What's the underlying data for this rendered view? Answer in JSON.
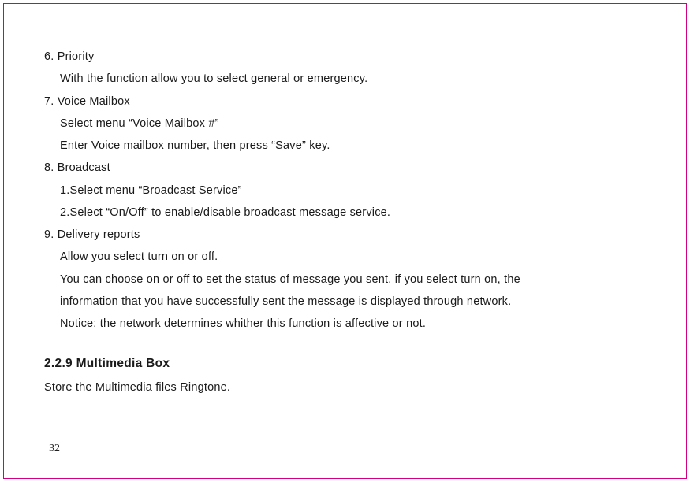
{
  "items": [
    {
      "num": "6",
      "title": "Priority",
      "lines": [
        "With the function allow you to select general or emergency."
      ]
    },
    {
      "num": "7",
      "title": "Voice Mailbox",
      "lines": [
        "Select menu “Voice Mailbox #”",
        "Enter Voice mailbox number, then press “Save” key."
      ]
    },
    {
      "num": "8",
      "title": "Broadcast",
      "lines": [
        "1.Select menu “Broadcast Service”",
        "2.Select “On/Off” to enable/disable broadcast message service."
      ]
    },
    {
      "num": "9",
      "title": "Delivery reports",
      "lines": [
        "Allow you select turn on or off.",
        "You can choose on or off to set the status of message you sent, if you select turn on, the",
        "information that you have successfully sent the message is displayed through network.",
        "Notice: the network determines whither this function is affective or not."
      ]
    }
  ],
  "section": {
    "heading": "2.2.9 Multimedia Box",
    "body": "Store the Multimedia files Ringtone."
  },
  "pageNumber": "32"
}
